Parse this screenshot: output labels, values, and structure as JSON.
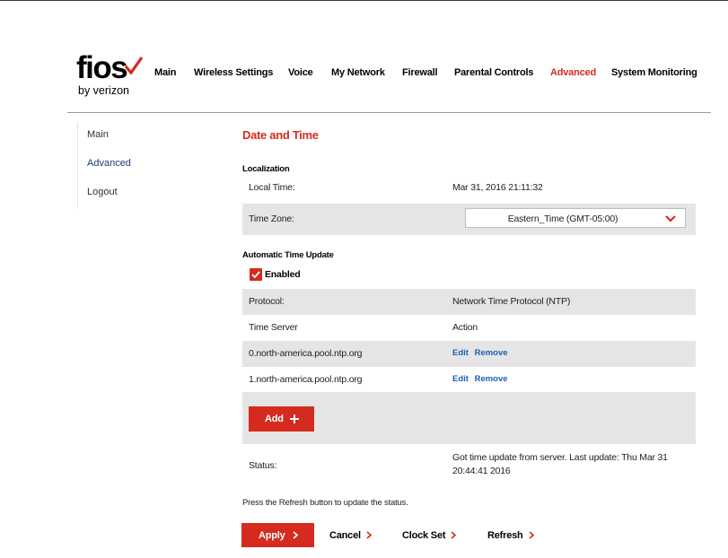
{
  "brand": {
    "wordmark": "fios",
    "tagline": "by verizon",
    "accent": "#d52b1e"
  },
  "topnav": {
    "items": [
      "Main",
      "Wireless Settings",
      "Voice",
      "My Network",
      "Firewall",
      "Parental Controls",
      "Advanced",
      "System Monitoring"
    ],
    "active": "Advanced"
  },
  "sidenav": {
    "items": [
      "Main",
      "Advanced",
      "Logout"
    ],
    "active": "Advanced"
  },
  "page": {
    "title": "Date and Time",
    "localization": {
      "heading": "Localization",
      "local_time_label": "Local Time:",
      "local_time_value": "Mar 31, 2016 21:11:32",
      "time_zone_label": "Time Zone:",
      "time_zone_value": "Eastern_Time (GMT-05:00)"
    },
    "auto_update": {
      "heading": "Automatic Time Update",
      "enabled_label": "Enabled",
      "enabled": true,
      "protocol_label": "Protocol:",
      "protocol_value": "Network Time Protocol (NTP)",
      "server_col": "Time Server",
      "action_col": "Action",
      "servers": [
        {
          "name": "0.north-america.pool.ntp.org",
          "edit": "Edit",
          "remove": "Remove"
        },
        {
          "name": "1.north-america.pool.ntp.org",
          "edit": "Edit",
          "remove": "Remove"
        }
      ],
      "add_label": "Add"
    },
    "status": {
      "label": "Status:",
      "value": "Got time update from server. Last update: Thu Mar 31 20:44:41 2016"
    },
    "note": "Press the Refresh button to update the status.",
    "actions": {
      "apply": "Apply",
      "cancel": "Cancel",
      "clock_set": "Clock Set",
      "refresh": "Refresh"
    }
  }
}
